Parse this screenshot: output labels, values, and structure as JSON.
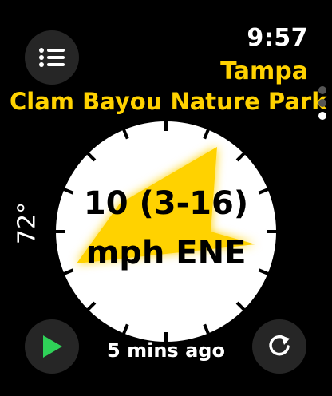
{
  "status": {
    "time": "9:57"
  },
  "location": {
    "city": "Tampa",
    "spot": "Clam Bayou Nature Park"
  },
  "weather": {
    "temperature": "72°"
  },
  "wind": {
    "speed_line": "10 (3-16)",
    "unit_direction_line": "mph ENE",
    "arrow_heading_deg": 67.5
  },
  "footer": {
    "updated": "5 mins ago"
  },
  "icons": {
    "menu": "list-icon",
    "play": "play-icon",
    "refresh": "refresh-icon"
  },
  "colors": {
    "accent": "#ffd200",
    "play_green": "#2fd158",
    "button_bg": "#262626",
    "dial_face": "#ffffff"
  },
  "pager": {
    "page_count": 3,
    "active_page": 3
  }
}
